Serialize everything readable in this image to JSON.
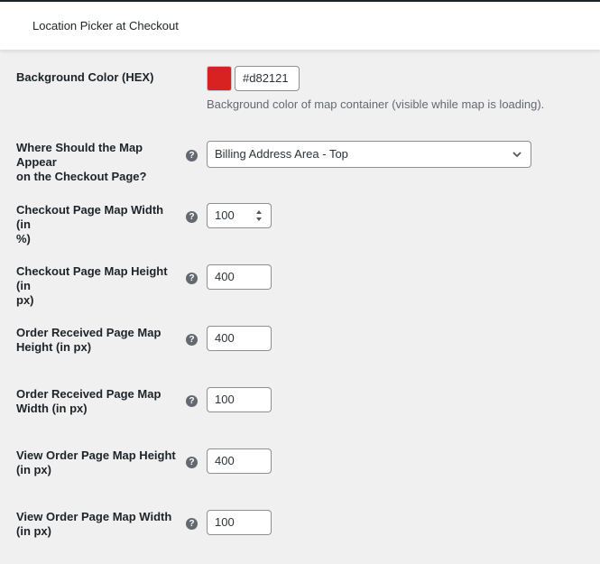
{
  "header": {
    "title": "Location Picker at Checkout"
  },
  "background_color": {
    "label": "Background Color (HEX)",
    "swatch_color": "#d82121",
    "value": "#d82121",
    "description": "Background color of map container (visible while map is loading)."
  },
  "map_position": {
    "label_line1": "Where Should the Map Appear",
    "label_line2": "on the Checkout Page?",
    "help_icon": "?",
    "selected": "Billing Address Area - Top"
  },
  "fields": [
    {
      "label_line1": "Checkout Page Map Width (in",
      "label_line2": "%)",
      "help_icon": "?",
      "value": "100"
    },
    {
      "label_line1": "Checkout Page Map Height (in",
      "label_line2": "px)",
      "help_icon": "?",
      "value": "400"
    },
    {
      "label_line1": "Order Received Page Map",
      "label_line2": "Height (in px)",
      "help_icon": "?",
      "value": "400"
    },
    {
      "label_line1": "Order Received Page Map",
      "label_line2": "Width (in px)",
      "help_icon": "?",
      "value": "100"
    },
    {
      "label_line1": "View Order Page Map Height",
      "label_line2": "(in px)",
      "help_icon": "?",
      "value": "400"
    },
    {
      "label_line1": "View Order Page Map Width",
      "label_line2": "(in px)",
      "help_icon": "?",
      "value": "100"
    }
  ]
}
